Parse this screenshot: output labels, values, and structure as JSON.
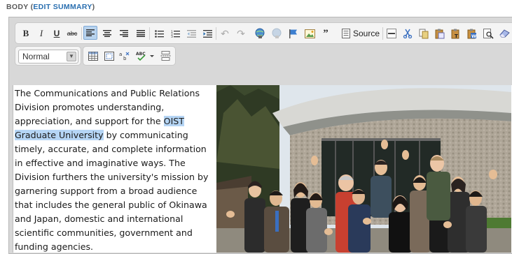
{
  "field": {
    "label": "BODY",
    "edit_link": "EDIT SUMMARY"
  },
  "toolbar": {
    "row1": [
      {
        "name": "bold-button",
        "glyph": "B"
      },
      {
        "name": "italic-button",
        "glyph": "I"
      },
      {
        "name": "underline-button",
        "glyph": "U"
      },
      {
        "name": "strikethrough-button",
        "glyph": "abc"
      }
    ],
    "source_label": "Source",
    "format_value": "Normal"
  },
  "content": {
    "paragraph_before": "The Communications and Public Relations Division promotes understanding, appreciation, and support for the ",
    "highlighted": "OIST Graduate University",
    "paragraph_after": " by communicating timely, accurate, and complete information in effective and imaginative ways. The Division furthers the university's mission by garnering support from a broad audience that includes the general public of Okinawa and Japan, domestic and international scientific communities, government and funding agencies."
  }
}
